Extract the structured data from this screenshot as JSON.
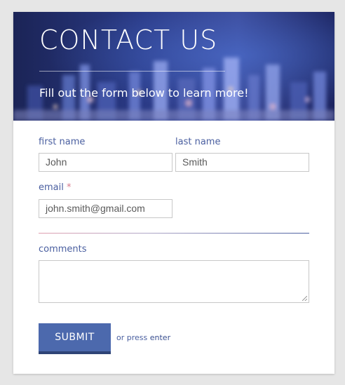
{
  "header": {
    "title": "CONTACT US",
    "subtitle": "Fill out the form below to learn more!"
  },
  "form": {
    "first_name": {
      "label": "first name",
      "value": "John"
    },
    "last_name": {
      "label": "last name",
      "value": "Smith"
    },
    "email": {
      "label": "email",
      "required_mark": "*",
      "value": "john.smith@gmail.com"
    },
    "comments": {
      "label": "comments",
      "value": ""
    },
    "submit_label": "SUBMIT",
    "press_prefix": "or press",
    "press_key": "enter"
  },
  "colors": {
    "accent": "#4c69ad",
    "label": "#4a5fa0",
    "required": "#d77a8c",
    "page_background": "#e6e6e6"
  }
}
